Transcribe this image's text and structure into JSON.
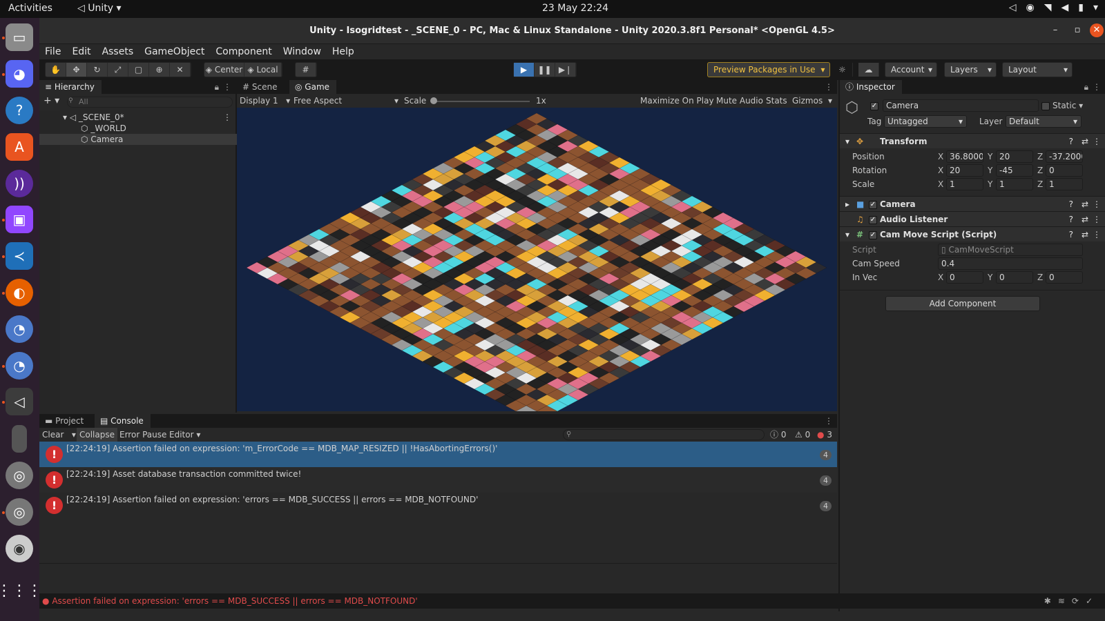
{
  "topbar": {
    "activities": "Activities",
    "app_name": "Unity",
    "clock": "23 May  22:24"
  },
  "dock": {
    "items": [
      "files-icon",
      "discord-icon",
      "help-icon",
      "software-icon",
      "podcast-icon",
      "twitch-icon",
      "vscode-icon",
      "firefox-icon",
      "krita-icon",
      "krita-icon-2",
      "unity-icon",
      "tablet-icon",
      "disk-icon",
      "disk-icon-2",
      "cd-icon",
      "app-grid-icon"
    ]
  },
  "window": {
    "title": "Unity - Isogridtest - _SCENE_0 - PC, Mac & Linux Standalone - Unity 2020.3.8f1 Personal* <OpenGL 4.5>"
  },
  "menu": [
    "File",
    "Edit",
    "Assets",
    "GameObject",
    "Component",
    "Window",
    "Help"
  ],
  "toolbar": {
    "pivot_label": "Center",
    "space_label": "Local",
    "preview_packages": "Preview Packages in Use",
    "account": "Account",
    "layers": "Layers",
    "layout": "Layout"
  },
  "hierarchy": {
    "tab": "Hierarchy",
    "search_placeholder": "All",
    "scene": "_SCENE_0*",
    "items": [
      "_WORLD",
      "Camera"
    ]
  },
  "game": {
    "tab_scene": "Scene",
    "tab_game": "Game",
    "display": "Display 1",
    "aspect": "Free Aspect",
    "scale_label": "Scale",
    "scale_value": "1x",
    "maximize": "Maximize On Play",
    "mute": "Mute Audio",
    "stats": "Stats",
    "gizmos": "Gizmos"
  },
  "inspector": {
    "tab": "Inspector",
    "object_name": "Camera",
    "static_label": "Static",
    "tag_label": "Tag",
    "tag_value": "Untagged",
    "layer_label": "Layer",
    "layer_value": "Default",
    "transform": {
      "title": "Transform",
      "position_label": "Position",
      "rotation_label": "Rotation",
      "scale_label": "Scale",
      "position": {
        "x": "36.8000:",
        "y": "20",
        "z": "-37.2000"
      },
      "rotation": {
        "x": "20",
        "y": "-45",
        "z": "0"
      },
      "scale": {
        "x": "1",
        "y": "1",
        "z": "1"
      }
    },
    "camera_comp": "Camera",
    "audio_comp": "Audio Listener",
    "script_comp": "Cam Move Script (Script)",
    "script_label": "Script",
    "script_value": "CamMoveScript",
    "cam_speed_label": "Cam Speed",
    "cam_speed_value": "0.4",
    "in_vec_label": "In Vec",
    "in_vec": {
      "x": "0",
      "y": "0",
      "z": "0"
    },
    "add_component": "Add Component"
  },
  "console": {
    "tab_project": "Project",
    "tab_console": "Console",
    "clear": "Clear",
    "collapse": "Collapse",
    "error_pause": "Error Pause",
    "editor": "Editor",
    "info_count": "0",
    "warn_count": "0",
    "error_count": "3",
    "logs": [
      {
        "text": "[22:24:19] Assertion failed on expression: 'm_ErrorCode == MDB_MAP_RESIZED || !HasAbortingErrors()'",
        "count": "4"
      },
      {
        "text": "[22:24:19] Asset database transaction committed twice!",
        "count": "4"
      },
      {
        "text": "[22:24:19] Assertion failed on expression: 'errors == MDB_SUCCESS || errors == MDB_NOTFOUND'",
        "count": "4"
      }
    ]
  },
  "status": {
    "message": "Assertion failed on expression: 'errors == MDB_SUCCESS || errors == MDB_NOTFOUND'"
  }
}
